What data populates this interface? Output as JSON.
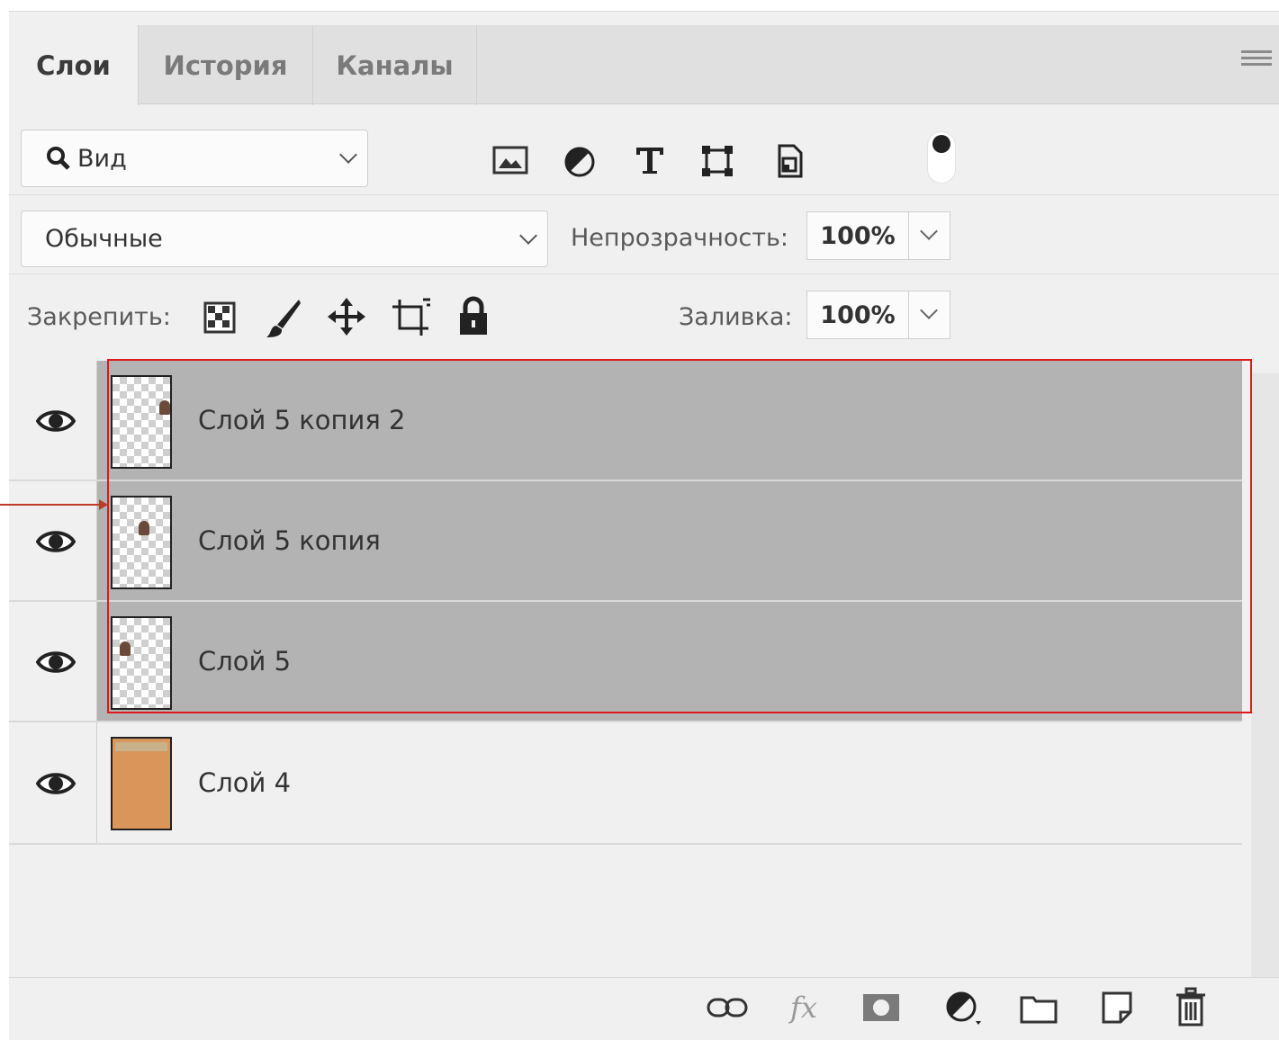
{
  "tabs": [
    {
      "label": "Слои",
      "active": true
    },
    {
      "label": "История",
      "active": false
    },
    {
      "label": "Каналы",
      "active": false
    }
  ],
  "filter": {
    "label": "Вид"
  },
  "blend_mode": "Обычные",
  "opacity": {
    "label": "Непрозрачность:",
    "value": "100%"
  },
  "lock": {
    "label": "Закрепить:"
  },
  "fill": {
    "label": "Заливка:",
    "value": "100%"
  },
  "layers": [
    {
      "name": "Слой 5 копия 2",
      "selected": true,
      "visible": true
    },
    {
      "name": "Слой 5 копия",
      "selected": true,
      "visible": true
    },
    {
      "name": "Слой 5",
      "selected": true,
      "visible": true
    },
    {
      "name": "Слой 4",
      "selected": false,
      "visible": true
    }
  ],
  "colors": {
    "selection_box": "#e0191f",
    "selected_row": "#b3b3b3",
    "panel_bg": "#f0f0f0"
  }
}
